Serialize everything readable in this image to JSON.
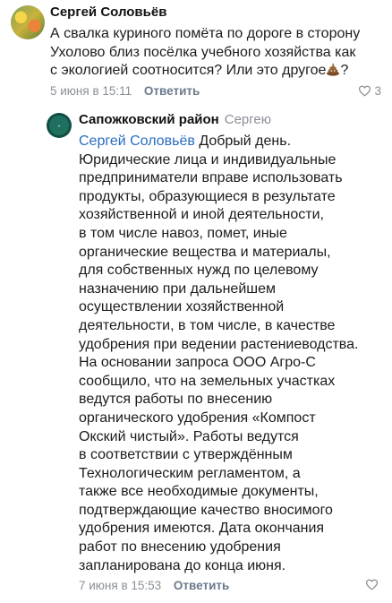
{
  "comments": [
    {
      "author": "Сергей Соловьёв",
      "text_lines": [
        "А свалка куриного помёта по дороге в сторону",
        "Ухолово близ посёлка учебного хозяйства как",
        "с экологией соотносится? Или это другое"
      ],
      "text_tail": "?",
      "emoji": "poop-emoji",
      "date": "5 июня в 15:11",
      "reply_label": "Ответить",
      "likes": "3"
    },
    {
      "author": "Сапожковский район",
      "reply_to": "Сергею",
      "mention": "Сергей Соловьёв",
      "first_line_rest": " Добрый день.",
      "text_lines": [
        "Юридические лица и индивидуальные",
        "предприниматели вправе использовать",
        "продукты, образующиеся в результате",
        "хозяйственной и иной деятельности,",
        "в том числе навоз, помет, иные",
        "органические вещества и материалы,",
        "для собственных нужд по целевому",
        "назначению при дальнейшем",
        "осуществлении хозяйственной",
        "деятельности, в том числе, в качестве",
        "удобрения при ведении растениеводства.",
        "На основании запроса ООО Агро-С",
        "сообщило, что на земельных участках",
        "ведутся работы по внесению",
        "органического удобрения «Компост",
        "Окский чистый». Работы ведутся",
        "в соответствии с утверждённым",
        "Технологическим регламентом, а",
        "также все необходимые документы,",
        "подтверждающие качество вносимого",
        "удобрения имеются. Дата окончания",
        "работ по внесению удобрения",
        "запланирована до конца июня."
      ],
      "date": "7 июня в 15:53",
      "reply_label": "Ответить",
      "likes": ""
    }
  ],
  "colors": {
    "mention": "#2a6cc2",
    "meta": "#8a8f96",
    "reply_link": "#6b7a8c"
  }
}
